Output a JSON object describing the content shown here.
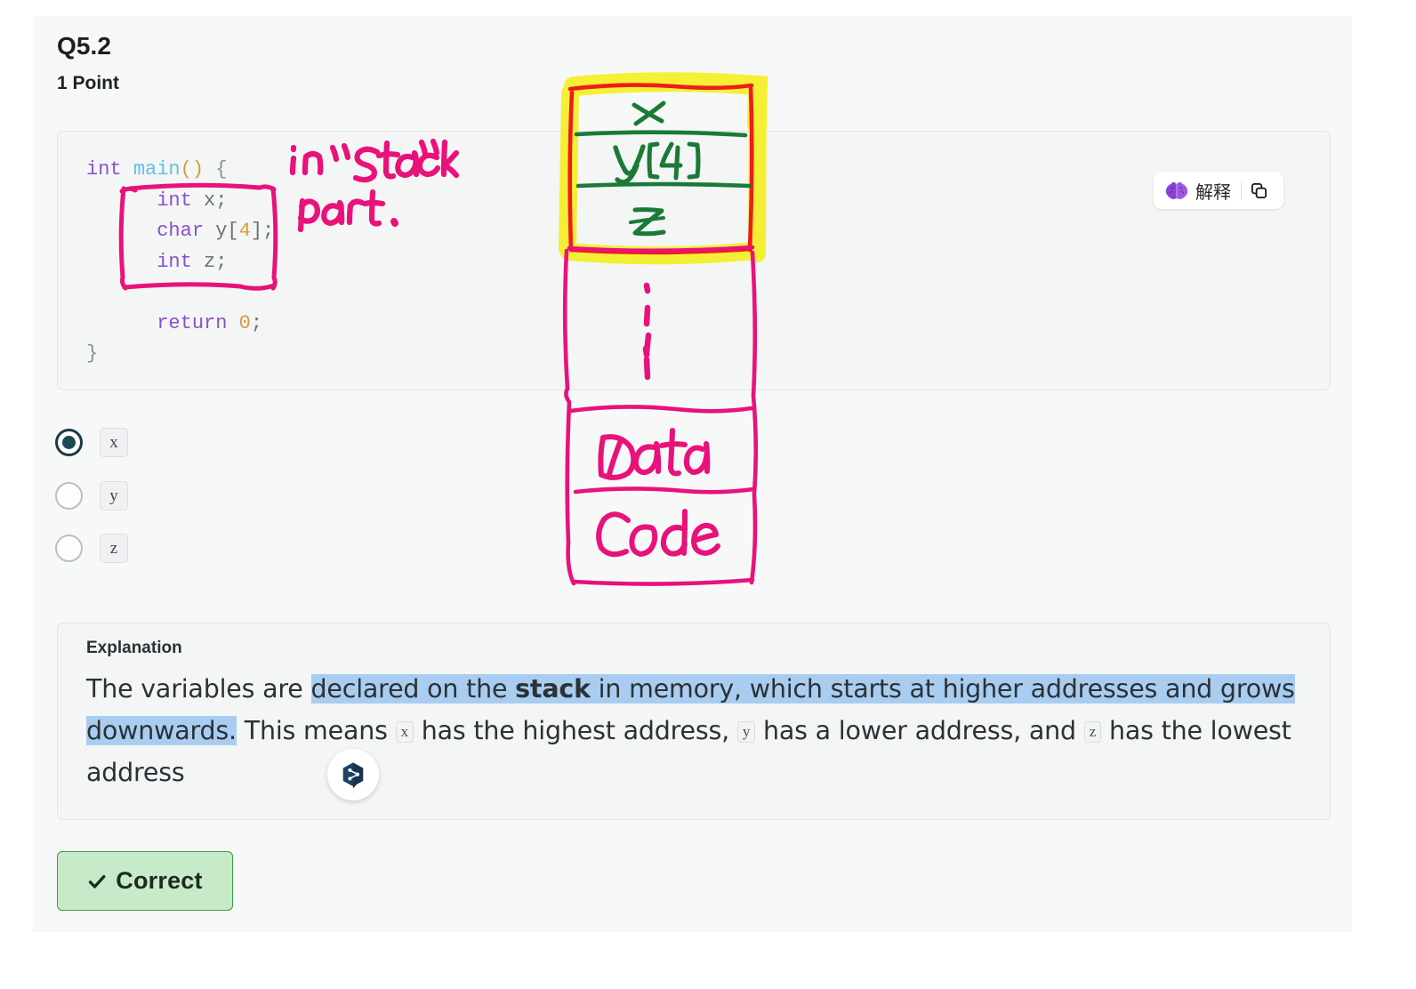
{
  "header": {
    "question_number": "Q5.2",
    "points": "1 Point"
  },
  "code_card": {
    "lines": [
      {
        "indent": 0,
        "tokens": [
          {
            "t": "int",
            "c": "kw"
          },
          {
            "t": " ",
            "c": "plain"
          },
          {
            "t": "main",
            "c": "fn"
          },
          {
            "t": "()",
            "c": "punc"
          },
          {
            "t": " ",
            "c": "plain"
          },
          {
            "t": "{",
            "c": "br"
          }
        ]
      },
      {
        "indent": 1,
        "tokens": [
          {
            "t": "int",
            "c": "kw"
          },
          {
            "t": " ",
            "c": "plain"
          },
          {
            "t": "x;",
            "c": "id"
          }
        ]
      },
      {
        "indent": 1,
        "tokens": [
          {
            "t": "char",
            "c": "kw"
          },
          {
            "t": " ",
            "c": "plain"
          },
          {
            "t": "y[",
            "c": "id"
          },
          {
            "t": "4",
            "c": "num"
          },
          {
            "t": "];",
            "c": "id"
          }
        ]
      },
      {
        "indent": 1,
        "tokens": [
          {
            "t": "int",
            "c": "kw"
          },
          {
            "t": " ",
            "c": "plain"
          },
          {
            "t": "z;",
            "c": "id"
          }
        ]
      },
      {
        "indent": 0,
        "tokens": []
      },
      {
        "indent": 1,
        "tokens": [
          {
            "t": "return",
            "c": "kw"
          },
          {
            "t": " ",
            "c": "plain"
          },
          {
            "t": "0",
            "c": "num"
          },
          {
            "t": ";",
            "c": "id"
          }
        ]
      },
      {
        "indent": 0,
        "tokens": [
          {
            "t": "}",
            "c": "br"
          }
        ]
      }
    ],
    "explain_button_label": "解释",
    "brain_icon": "brain-icon",
    "copy_icon": "copy-icon"
  },
  "options": [
    {
      "label": "x",
      "selected": true
    },
    {
      "label": "y",
      "selected": false
    },
    {
      "label": "z",
      "selected": false
    }
  ],
  "explanation": {
    "title": "Explanation",
    "segments": [
      {
        "text": "The variables are ",
        "style": "plain"
      },
      {
        "text": "declared on the ",
        "style": "selected"
      },
      {
        "text": "stack",
        "style": "selected-bold"
      },
      {
        "text": " in memory, which starts at higher addresses and grows downwards.",
        "style": "selected"
      },
      {
        "text": " This means ",
        "style": "plain"
      },
      {
        "text": "x",
        "style": "chip"
      },
      {
        "text": " has the highest address, ",
        "style": "plain"
      },
      {
        "text": "y",
        "style": "chip"
      },
      {
        "text": " has a lower address, and ",
        "style": "plain"
      },
      {
        "text": "z",
        "style": "chip"
      },
      {
        "text": " has the lowest address",
        "style": "plain"
      }
    ],
    "badge_icon": "share-node-hex-icon"
  },
  "result": {
    "label": "Correct",
    "icon": "check-icon",
    "bg_color": "#c7ebc9",
    "border_color": "#3f9d46"
  },
  "annotations": {
    "ink_color_pink": "#e8127a",
    "ink_color_green": "#1a7a36",
    "ink_color_red": "#ee1c1c",
    "highlight_yellow": "#f5ef1a",
    "handwriting": [
      {
        "text": "in \" Stack\"",
        "color": "pink"
      },
      {
        "text": "part .",
        "color": "pink"
      },
      {
        "text": "x",
        "color": "green"
      },
      {
        "text": "y[4]",
        "color": "green"
      },
      {
        "text": "z",
        "color": "green"
      },
      {
        "text": "Data",
        "color": "pink"
      },
      {
        "text": "Code",
        "color": "pink"
      }
    ]
  }
}
